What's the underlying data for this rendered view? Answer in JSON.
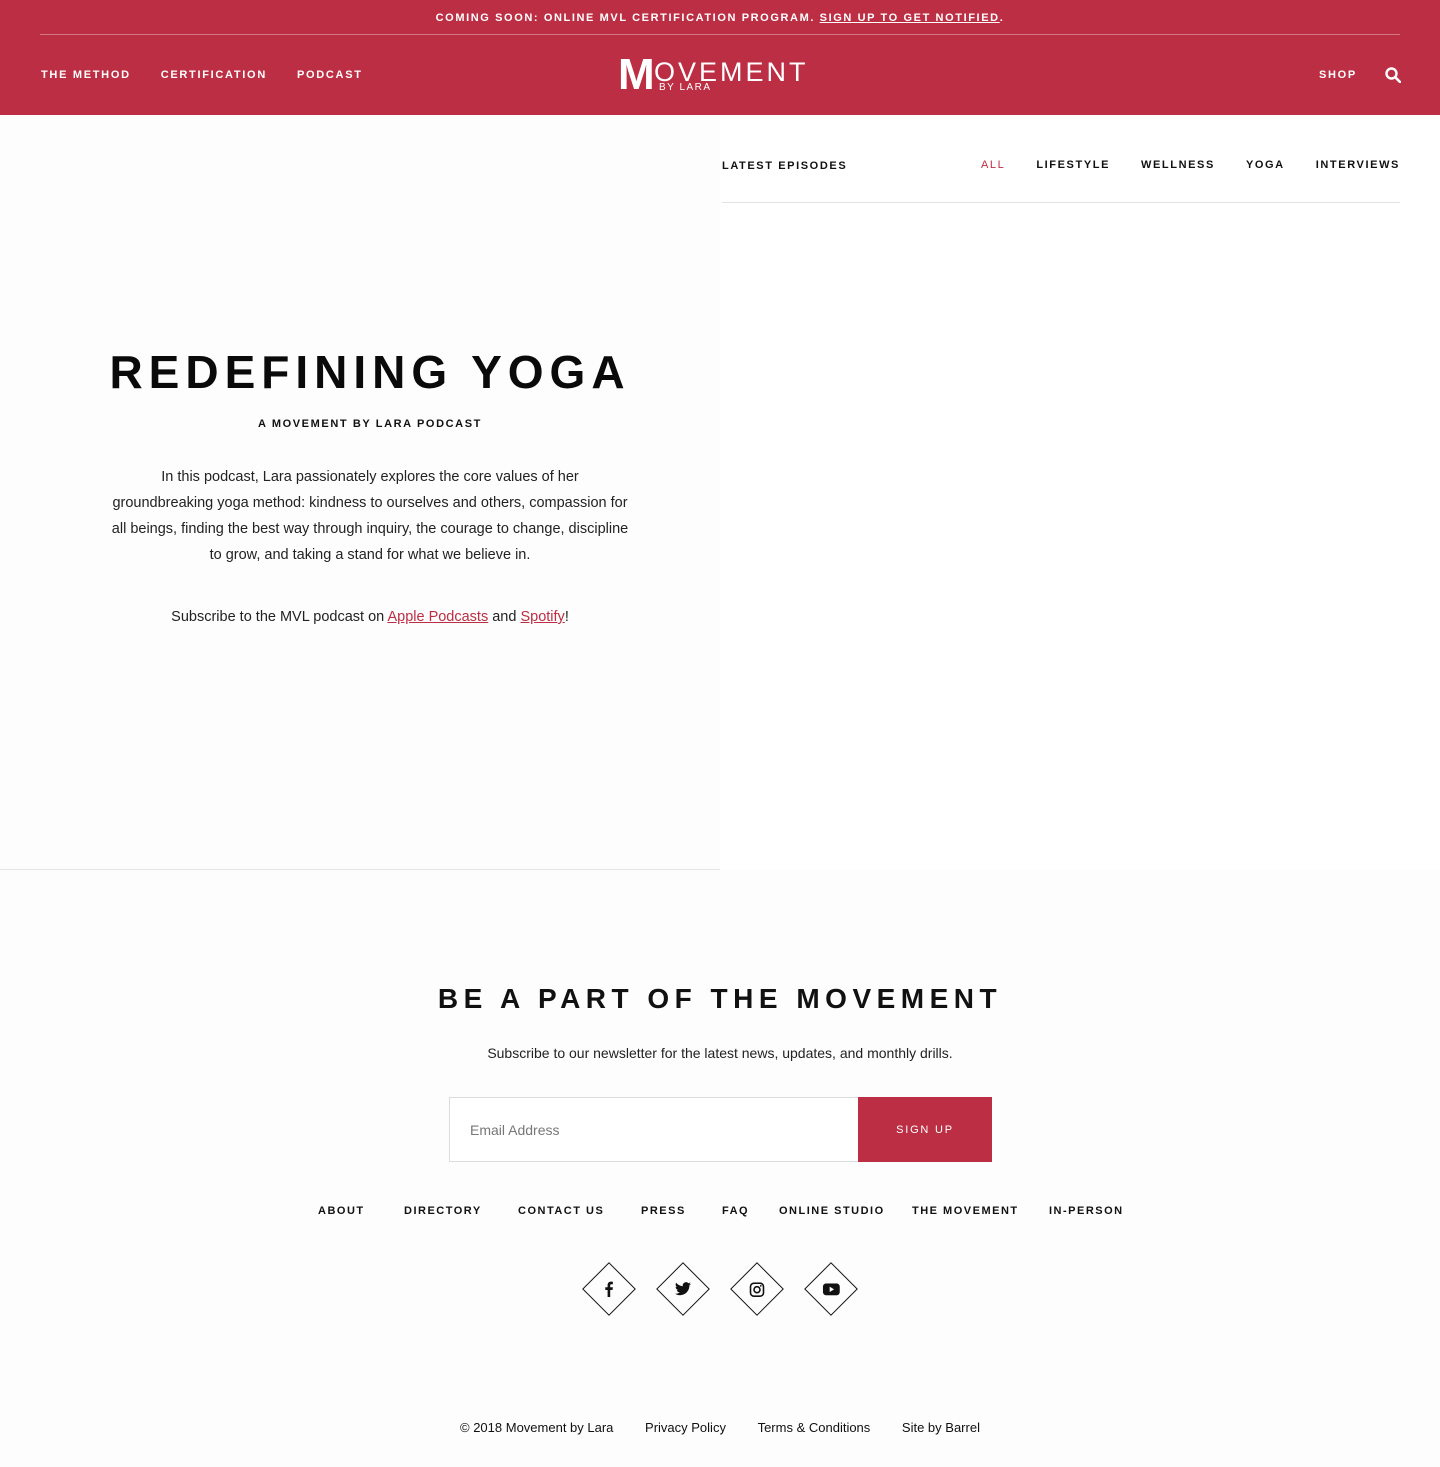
{
  "announcement": {
    "text": "COMING SOON: ONLINE MVL CERTIFICATION PROGRAM. ",
    "link": "SIGN UP TO GET NOTIFIED",
    "tail": "."
  },
  "nav": {
    "left": [
      "THE METHOD",
      "CERTIFICATION",
      "PODCAST"
    ],
    "shop": "SHOP"
  },
  "logo": {
    "m": "M",
    "rest": "OVEMENT",
    "sub": "BY LARA"
  },
  "hero": {
    "title": "REDEFINING YOGA",
    "subtitle": "A MOVEMENT BY LARA PODCAST",
    "description": "In this podcast, Lara passionately explores the core values of her groundbreaking yoga method: kindness to ourselves and others, compassion for all beings, finding the best way through inquiry, the courage to change, discipline to grow, and taking a stand for what we believe in.",
    "subscribe_prefix": "Subscribe to the MVL podcast on ",
    "apple": "Apple Podcasts",
    "and": " and ",
    "spotify": "Spotify",
    "suffix": "!"
  },
  "episodes": {
    "title": "LATEST EPISODES",
    "filters": [
      "ALL",
      "LIFESTYLE",
      "WELLNESS",
      "YOGA",
      "INTERVIEWS"
    ],
    "active_filter": "ALL"
  },
  "newsletter": {
    "title": "BE A PART OF THE MOVEMENT",
    "description": "Subscribe to our newsletter for the latest news, updates, and monthly drills.",
    "email_placeholder": "Email Address",
    "button": "SIGN UP"
  },
  "footer": {
    "links": [
      "ABOUT",
      "DIRECTORY",
      "CONTACT US",
      "PRESS",
      "FAQ",
      "ONLINE STUDIO",
      "THE MOVEMENT",
      "IN-PERSON"
    ],
    "social": [
      "facebook-icon",
      "twitter-icon",
      "instagram-icon",
      "youtube-icon"
    ],
    "legal": [
      "© 2018 Movement by Lara",
      "Privacy Policy",
      "Terms & Conditions",
      "Site by Barrel"
    ]
  },
  "colors": {
    "brand": "#bc2e43",
    "text": "#111111"
  }
}
